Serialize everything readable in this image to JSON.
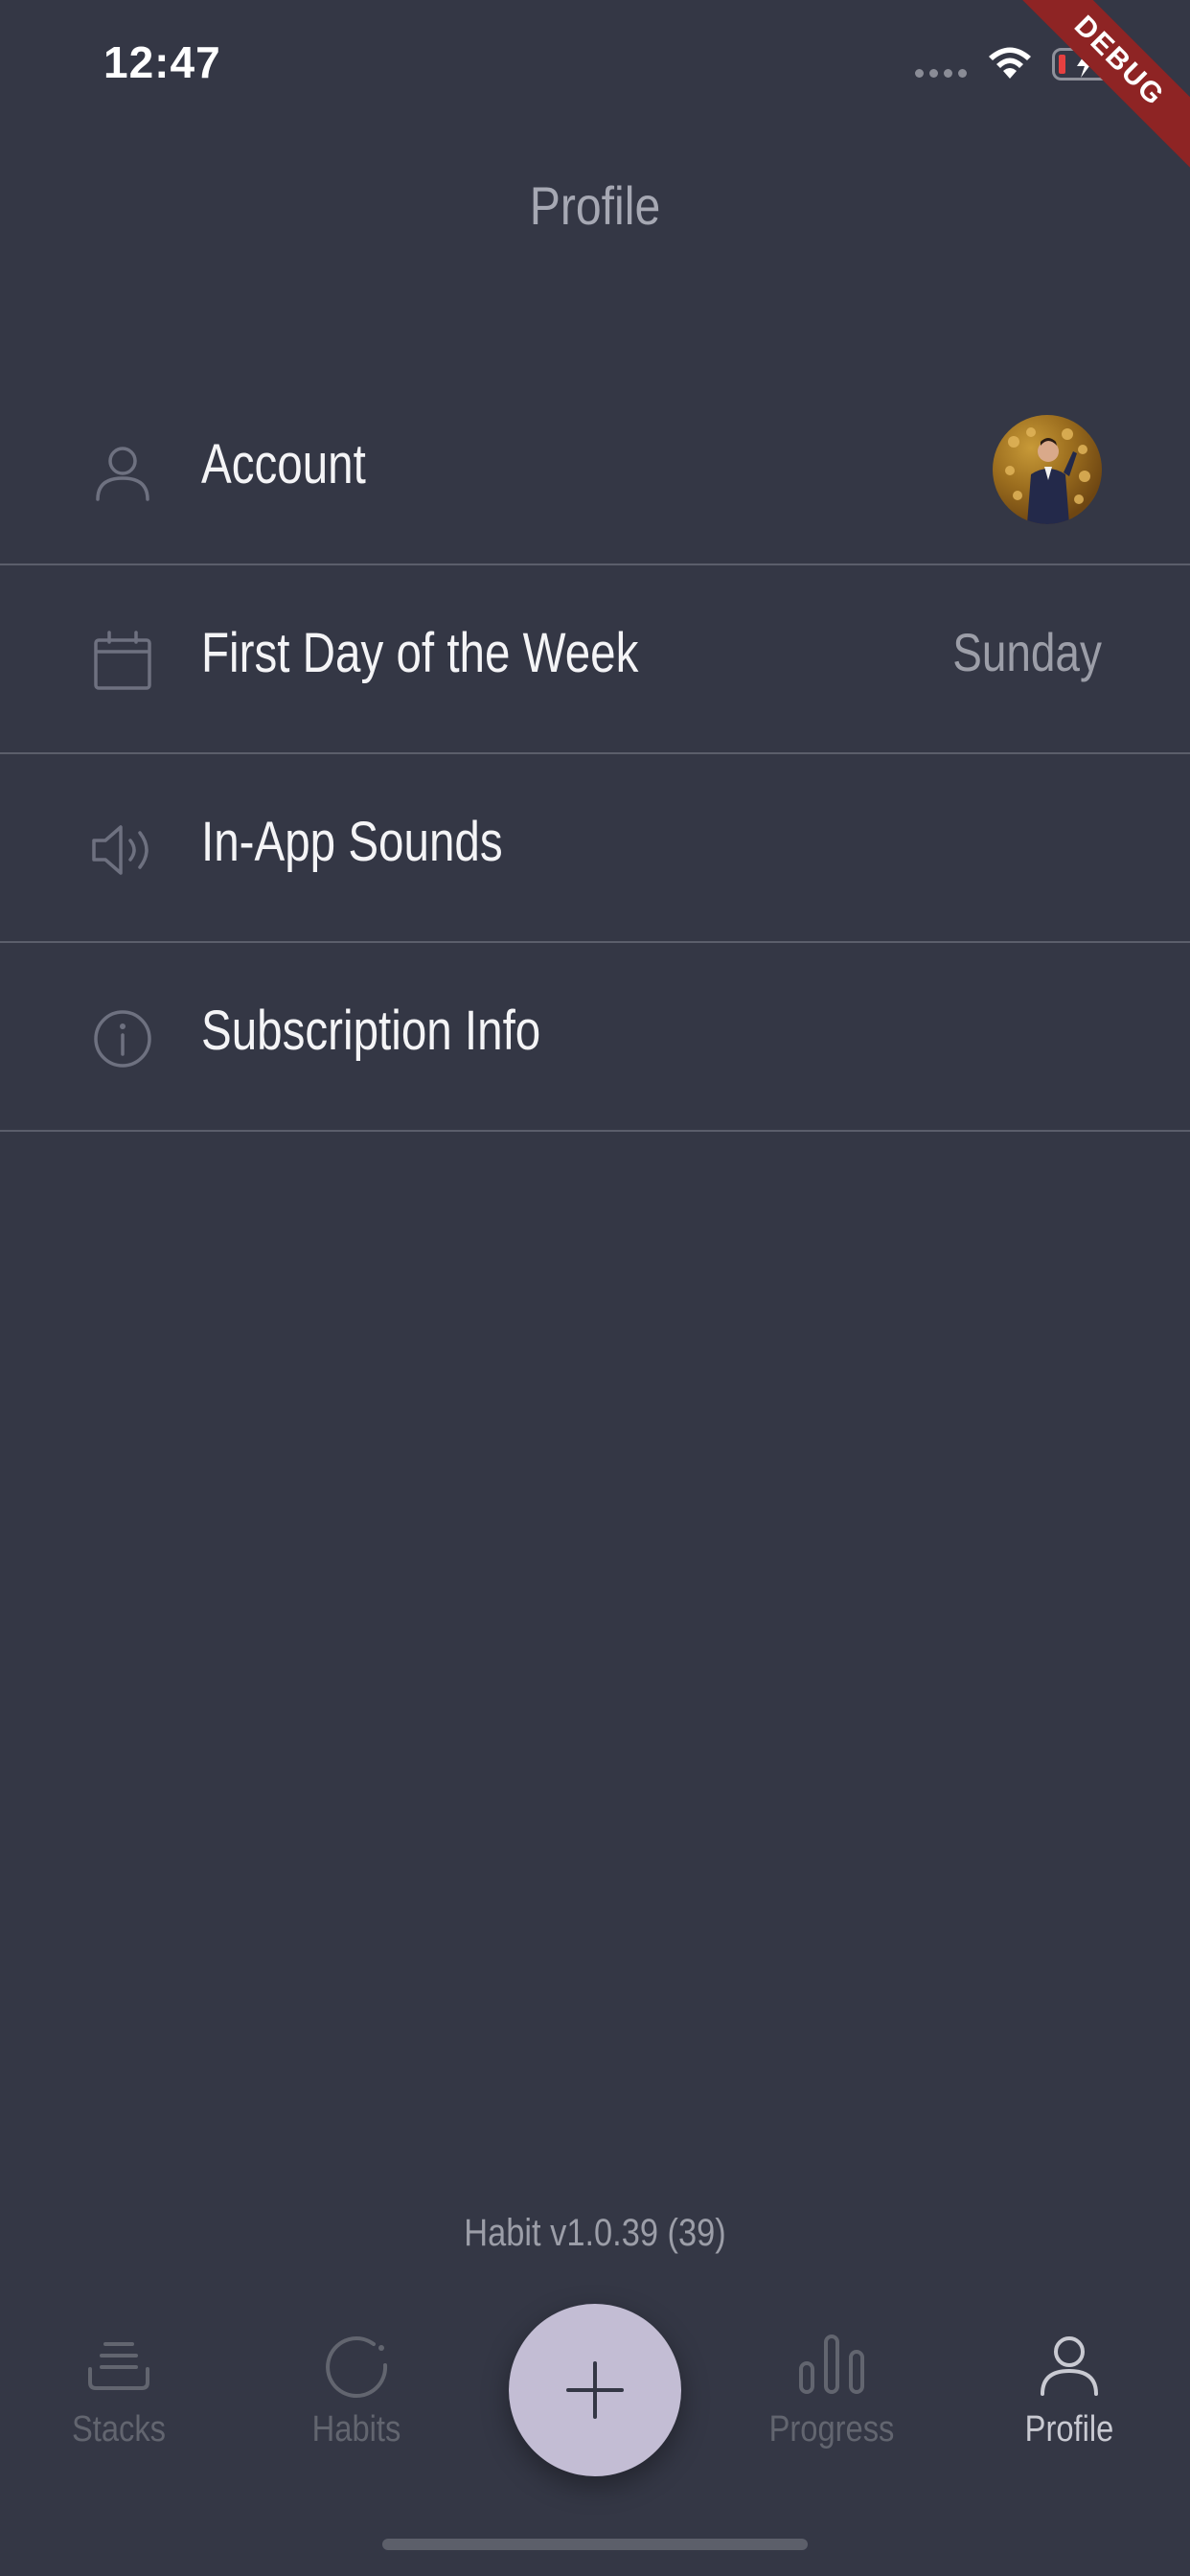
{
  "status_bar": {
    "time": "12:47",
    "debug_label": "DEBUG"
  },
  "header": {
    "title": "Profile"
  },
  "settings": {
    "items": [
      {
        "label": "Account",
        "value": "",
        "icon": "person-icon"
      },
      {
        "label": "First Day of the Week",
        "value": "Sunday",
        "icon": "calendar-icon"
      },
      {
        "label": "In-App Sounds",
        "value": "",
        "icon": "speaker-icon"
      },
      {
        "label": "Subscription Info",
        "value": "",
        "icon": "info-icon"
      }
    ]
  },
  "footer": {
    "version": "Habit v1.0.39 (39)"
  },
  "tab_bar": {
    "items": [
      {
        "label": "Stacks",
        "icon": "stacks-icon",
        "active": false
      },
      {
        "label": "Habits",
        "icon": "habits-icon",
        "active": false
      },
      {
        "label": "Progress",
        "icon": "progress-icon",
        "active": false
      },
      {
        "label": "Profile",
        "icon": "profile-icon",
        "active": true
      }
    ],
    "add_button_icon": "plus-icon"
  },
  "colors": {
    "background": "#343745",
    "divider": "#5b5e6b",
    "fab": "#c3bdd4",
    "active_tab": "#c9cad2",
    "inactive_tab": "#62656f",
    "debug_banner": "#8e2424"
  }
}
